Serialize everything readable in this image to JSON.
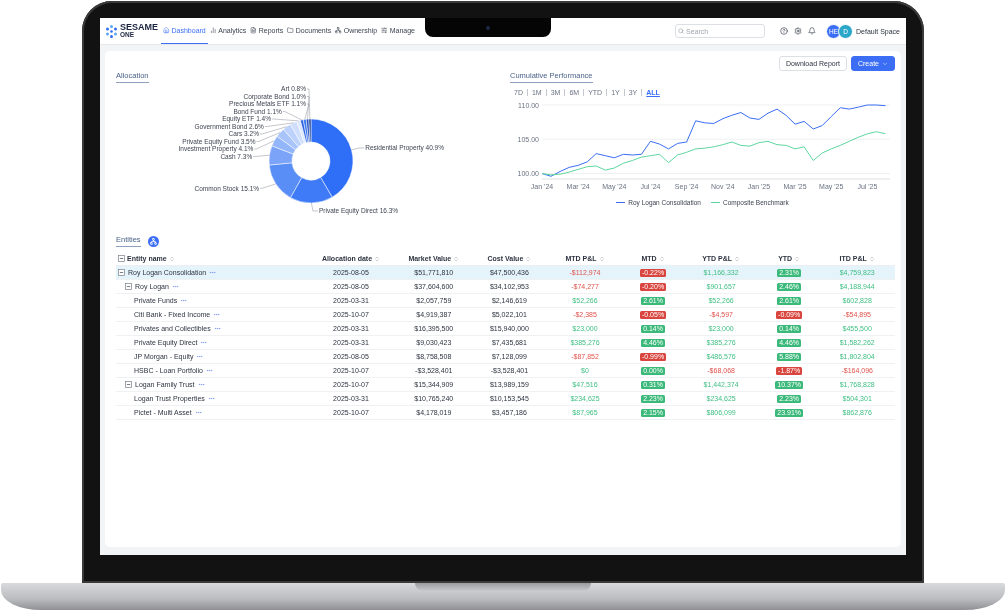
{
  "nav": {
    "logo": {
      "name": "SESAME",
      "sub": "ONE"
    },
    "items": [
      {
        "label": "Dashboard",
        "selected": true
      },
      {
        "label": "Analytics",
        "selected": false
      },
      {
        "label": "Reports",
        "selected": false
      },
      {
        "label": "Documents",
        "selected": false
      },
      {
        "label": "Ownership",
        "selected": false
      },
      {
        "label": "Manage",
        "selected": false
      }
    ],
    "search": {
      "placeholder": "Search"
    },
    "avatars": [
      "HE",
      "D"
    ],
    "space": "Default Space"
  },
  "toolbar": {
    "buttons": [
      {
        "label": "Download Report",
        "kind": "secondary"
      },
      {
        "label": "Create",
        "kind": "primary"
      }
    ]
  },
  "allocation": {
    "title": "Allocation",
    "chart_data": {
      "type": "donut",
      "categories": [
        "Residential Property",
        "Private Equity Direct",
        "Common Stock",
        "Cash",
        "Investment Property",
        "Private Equity Fund",
        "Cars",
        "Government Bond",
        "Equity ETF",
        "Bond Fund",
        "Precious Metals ETF",
        "Corporate Bond",
        "Art"
      ],
      "values": [
        40.9,
        16.3,
        15.1,
        7.3,
        4.1,
        3.5,
        3.2,
        2.6,
        1.4,
        1.1,
        1.1,
        1.0,
        0.8
      ],
      "value_labels": [
        "40.9%",
        "16.3%",
        "15.1%",
        "7.3%",
        "4.1%",
        "3.5%",
        "3.2%",
        "2.6%",
        "1.4%",
        "1.1%",
        "1.1%",
        "1.0%",
        "0.8%"
      ]
    }
  },
  "performance": {
    "title": "Cumulative Performance",
    "ranges": [
      {
        "label": "7D",
        "selected": false
      },
      {
        "label": "1M",
        "selected": false
      },
      {
        "label": "3M",
        "selected": false
      },
      {
        "label": "6M",
        "selected": false
      },
      {
        "label": "YTD",
        "selected": false
      },
      {
        "label": "1Y",
        "selected": false
      },
      {
        "label": "3Y",
        "selected": false
      },
      {
        "label": "ALL",
        "selected": true
      }
    ],
    "chart_data": {
      "type": "line",
      "categories": [
        "Jan '24",
        null,
        null,
        null,
        "Mar '24",
        null,
        null,
        null,
        "May '24",
        null,
        null,
        null,
        "Jul '24",
        null,
        null,
        null,
        "Sep '24",
        null,
        null,
        null,
        "Nov '24",
        null,
        null,
        null,
        "Jan '25",
        null,
        null,
        null,
        "Mar '25",
        null,
        null,
        null,
        "May '25",
        null,
        null,
        null,
        "Jul '25",
        null,
        null
      ],
      "series": [
        {
          "name": "Roy Logan Consolidation",
          "color": "#3b6ef5",
          "values": [
            100,
            99.6,
            100.3,
            100.9,
            101.2,
            101.7,
            102.9,
            102.6,
            102.3,
            102.8,
            102.7,
            102.8,
            104.7,
            104.3,
            103.6,
            104.4,
            104.6,
            107.7,
            107.4,
            107.3,
            108.0,
            108.5,
            108.9,
            108.1,
            107.9,
            108.8,
            109.4,
            108.5,
            107.2,
            107.6,
            106.5,
            107.0,
            108.3,
            109.6,
            109.4,
            109.7,
            110.0,
            110.0,
            109.9
          ]
        },
        {
          "name": "Composite Benchmark",
          "color": "#5fd6a0",
          "values": [
            100,
            99.8,
            99.9,
            100.2,
            100.6,
            101.0,
            101.1,
            100.5,
            100.8,
            101.5,
            101.9,
            102.4,
            102.6,
            102.8,
            101.6,
            102.7,
            103.1,
            103.6,
            103.7,
            103.9,
            104.2,
            104.6,
            104.1,
            104.0,
            104.5,
            104.7,
            104.2,
            104.1,
            103.6,
            103.9,
            101.9,
            103.0,
            103.6,
            104.1,
            104.7,
            105.3,
            105.8,
            106.1,
            105.8
          ]
        }
      ],
      "grid": true,
      "ylim": [
        99.2,
        110
      ],
      "yticks": [
        {
          "value": 100,
          "label": "100.00"
        },
        {
          "value": 105,
          "label": "105.00"
        },
        {
          "value": 110,
          "label": "110.00"
        }
      ]
    }
  },
  "entities": {
    "title": "Entities",
    "columns": [
      "Entity name",
      "Allocation date",
      "Market Value",
      "Cost Value",
      "MTD P&L",
      "MTD",
      "YTD P&L",
      "YTD",
      "ITD P&L"
    ],
    "rows": [
      {
        "name": "Roy Logan Consolidation",
        "selected": true,
        "expanded": true,
        "date": "2025-08-05",
        "market_value": "$51,771,810",
        "cost_value": "$47,500,436",
        "mtd_pnl": {
          "value": "-$112,974",
          "negative": true
        },
        "mtd": {
          "value": "-0.22%",
          "negative": true
        },
        "ytd_pnl": {
          "value": "$1,166,332",
          "negative": false
        },
        "ytd": {
          "value": "2.31%",
          "negative": false
        },
        "itd_pnl": {
          "value": "$4,759,823",
          "negative": false
        },
        "children": [
          {
            "name": "Roy Logan",
            "selected": false,
            "expanded": true,
            "date": "2025-08-05",
            "market_value": "$37,604,600",
            "cost_value": "$34,102,953",
            "mtd_pnl": {
              "value": "-$74,277",
              "negative": true
            },
            "mtd": {
              "value": "-0.20%",
              "negative": true
            },
            "ytd_pnl": {
              "value": "$901,657",
              "negative": false
            },
            "ytd": {
              "value": "2.46%",
              "negative": false
            },
            "itd_pnl": {
              "value": "$4,188,944",
              "negative": false
            },
            "children": [
              {
                "name": "Private Funds",
                "selected": false,
                "date": "2025-03-31",
                "market_value": "$2,057,759",
                "cost_value": "$2,146,619",
                "mtd_pnl": {
                  "value": "$52,266",
                  "negative": false
                },
                "mtd": {
                  "value": "2.61%",
                  "negative": false
                },
                "ytd_pnl": {
                  "value": "$52,266",
                  "negative": false
                },
                "ytd": {
                  "value": "2.61%",
                  "negative": false
                },
                "itd_pnl": {
                  "value": "$602,828",
                  "negative": false
                }
              },
              {
                "name": "Citi Bank - Fixed Income",
                "selected": false,
                "date": "2025-10-07",
                "market_value": "$4,919,387",
                "cost_value": "$5,022,101",
                "mtd_pnl": {
                  "value": "-$2,385",
                  "negative": true
                },
                "mtd": {
                  "value": "-0.05%",
                  "negative": true
                },
                "ytd_pnl": {
                  "value": "-$4,597",
                  "negative": true
                },
                "ytd": {
                  "value": "-0.09%",
                  "negative": true
                },
                "itd_pnl": {
                  "value": "-$54,895",
                  "negative": true
                }
              },
              {
                "name": "Privates and Collectibles",
                "selected": false,
                "date": "2025-03-31",
                "market_value": "$16,395,500",
                "cost_value": "$15,940,000",
                "mtd_pnl": {
                  "value": "$23,000",
                  "negative": false
                },
                "mtd": {
                  "value": "0.14%",
                  "negative": false
                },
                "ytd_pnl": {
                  "value": "$23,000",
                  "negative": false
                },
                "ytd": {
                  "value": "0.14%",
                  "negative": false
                },
                "itd_pnl": {
                  "value": "$455,500",
                  "negative": false
                }
              },
              {
                "name": "Private Equity Direct",
                "selected": false,
                "date": "2025-03-31",
                "market_value": "$9,030,423",
                "cost_value": "$7,435,681",
                "mtd_pnl": {
                  "value": "$385,276",
                  "negative": false
                },
                "mtd": {
                  "value": "4.46%",
                  "negative": false
                },
                "ytd_pnl": {
                  "value": "$385,276",
                  "negative": false
                },
                "ytd": {
                  "value": "4.46%",
                  "negative": false
                },
                "itd_pnl": {
                  "value": "$1,582,262",
                  "negative": false
                }
              },
              {
                "name": "JP Morgan - Equity",
                "selected": false,
                "date": "2025-08-05",
                "market_value": "$8,758,508",
                "cost_value": "$7,128,099",
                "mtd_pnl": {
                  "value": "-$87,852",
                  "negative": true
                },
                "mtd": {
                  "value": "-0.99%",
                  "negative": true
                },
                "ytd_pnl": {
                  "value": "$486,576",
                  "negative": false
                },
                "ytd": {
                  "value": "5.88%",
                  "negative": false
                },
                "itd_pnl": {
                  "value": "$1,802,804",
                  "negative": false
                }
              },
              {
                "name": "HSBC - Loan Portfolio",
                "selected": false,
                "date": "2025-10-07",
                "market_value": "-$3,528,401",
                "cost_value": "-$3,528,401",
                "mtd_pnl": {
                  "value": "$0",
                  "negative": false
                },
                "mtd": {
                  "value": "0.00%",
                  "negative": false
                },
                "ytd_pnl": {
                  "value": "-$68,068",
                  "negative": true
                },
                "ytd": {
                  "value": "-1.87%",
                  "negative": true
                },
                "itd_pnl": {
                  "value": "-$164,096",
                  "negative": true
                }
              }
            ]
          },
          {
            "name": "Logan Family Trust",
            "selected": false,
            "expanded": true,
            "date": "2025-10-07",
            "market_value": "$15,344,909",
            "cost_value": "$13,989,159",
            "mtd_pnl": {
              "value": "$47,516",
              "negative": false
            },
            "mtd": {
              "value": "0.31%",
              "negative": false
            },
            "ytd_pnl": {
              "value": "$1,442,374",
              "negative": false
            },
            "ytd": {
              "value": "10.37%",
              "negative": false
            },
            "itd_pnl": {
              "value": "$1,768,828",
              "negative": false
            },
            "children": [
              {
                "name": "Logan Trust Properties",
                "selected": false,
                "date": "2025-03-31",
                "market_value": "$10,765,240",
                "cost_value": "$10,153,545",
                "mtd_pnl": {
                  "value": "$234,625",
                  "negative": false
                },
                "mtd": {
                  "value": "2.23%",
                  "negative": false
                },
                "ytd_pnl": {
                  "value": "$234,625",
                  "negative": false
                },
                "ytd": {
                  "value": "2.23%",
                  "negative": false
                },
                "itd_pnl": {
                  "value": "$504,301",
                  "negative": false
                }
              },
              {
                "name": "Pictet - Multi Asset",
                "selected": false,
                "date": "2025-10-07",
                "market_value": "$4,178,019",
                "cost_value": "$3,457,186",
                "mtd_pnl": {
                  "value": "$87,965",
                  "negative": false
                },
                "mtd": {
                  "value": "2.15%",
                  "negative": false
                },
                "ytd_pnl": {
                  "value": "$806,099",
                  "negative": false
                },
                "ytd": {
                  "value": "23.91%",
                  "negative": false
                },
                "itd_pnl": {
                  "value": "$862,876",
                  "negative": false
                }
              }
            ]
          }
        ]
      }
    ]
  }
}
